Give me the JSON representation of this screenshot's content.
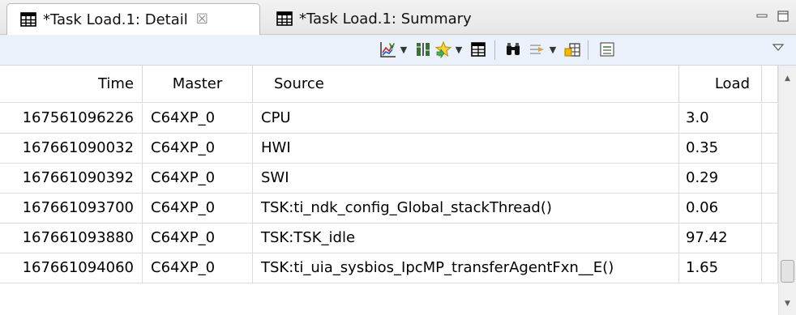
{
  "tabs": [
    {
      "label": "*Task Load.1: Detail",
      "icon": "table-icon",
      "active": true,
      "close_glyph": "☒"
    },
    {
      "label": "*Task Load.1: Summary",
      "icon": "table-icon",
      "active": false
    }
  ],
  "window_controls": [
    "minimize-icon",
    "maximize-icon"
  ],
  "toolbar": {
    "icons": [
      "chart-icon",
      "column-settings-icon",
      "highlight-star-icon",
      "grid-icon",
      "find-icon",
      "filter-icon",
      "export-icon",
      "view-menu-icon",
      "panel-menu-icon"
    ]
  },
  "table": {
    "headers": {
      "time": "Time",
      "master": "Master",
      "source": "Source",
      "load": "Load"
    },
    "rows": [
      {
        "time": "167561096226",
        "master": "C64XP_0",
        "source": "CPU",
        "load": "3.0"
      },
      {
        "time": "167661090032",
        "master": "C64XP_0",
        "source": "HWI",
        "load": "0.35"
      },
      {
        "time": "167661090392",
        "master": "C64XP_0",
        "source": "SWI",
        "load": "0.29"
      },
      {
        "time": "167661093700",
        "master": "C64XP_0",
        "source": "TSK:ti_ndk_config_Global_stackThread()",
        "load": "0.06"
      },
      {
        "time": "167661093880",
        "master": "C64XP_0",
        "source": "TSK:TSK_idle",
        "load": "97.42"
      },
      {
        "time": "167661094060",
        "master": "C64XP_0",
        "source": "TSK:ti_uia_sysbios_IpcMP_transferAgentFxn__E()",
        "load": "1.65"
      }
    ]
  },
  "colors": {
    "toolbar_bg": "#eaf1fb",
    "tabbar_bg": "#e6e6e6",
    "grid_line": "#dcdcdc",
    "accent_green": "#2e7d32",
    "accent_red": "#c62828"
  }
}
